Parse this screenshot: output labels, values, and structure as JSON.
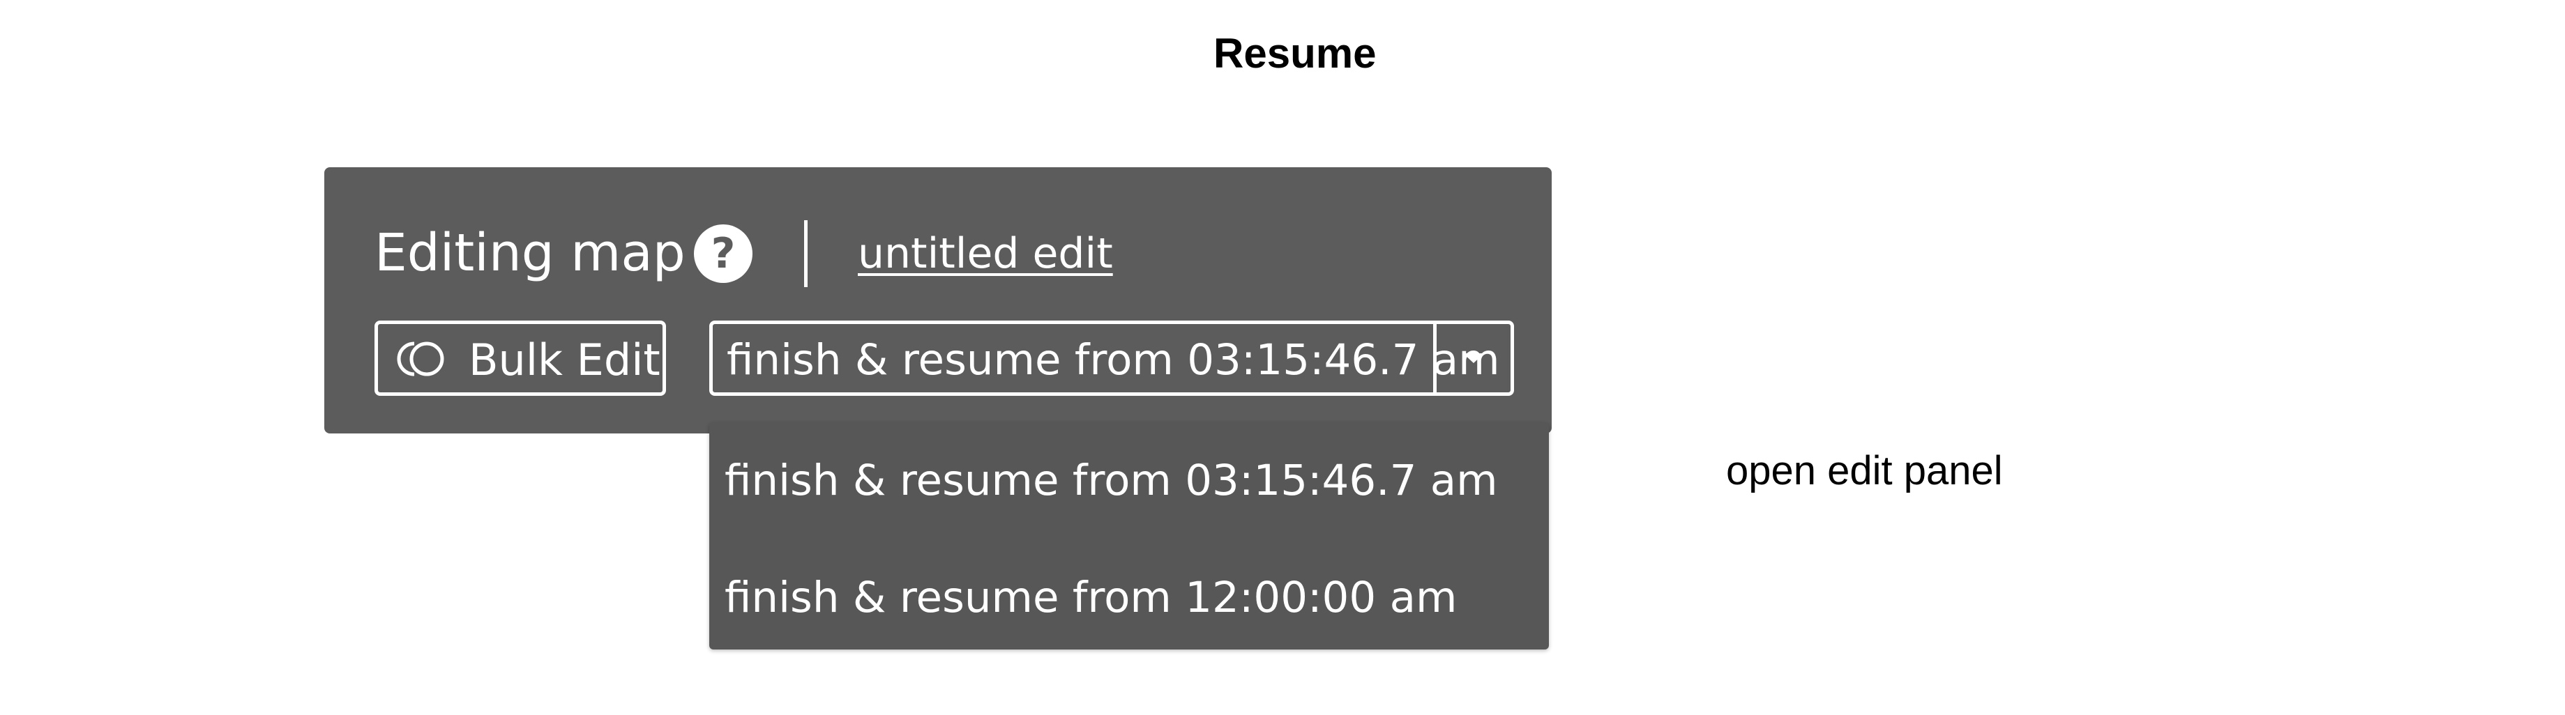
{
  "page": {
    "title": "Resume",
    "annotation": "open edit panel"
  },
  "panel": {
    "heading": "Editing map",
    "help_icon": "?",
    "edit_name": "untitled edit",
    "bulk_edit_label": "Bulk Edit",
    "bulk_edit_icon": "bulk-edit-icon",
    "select_value": "finish & resume from 03:15:46.7 am"
  },
  "dropdown": {
    "options": [
      "finish & resume from 03:15:46.7 am",
      "finish & resume from 12:00:00 am"
    ]
  },
  "colors": {
    "panel_bg": "#5c5c5c",
    "menu_bg": "#575757",
    "text": "#ffffff"
  }
}
